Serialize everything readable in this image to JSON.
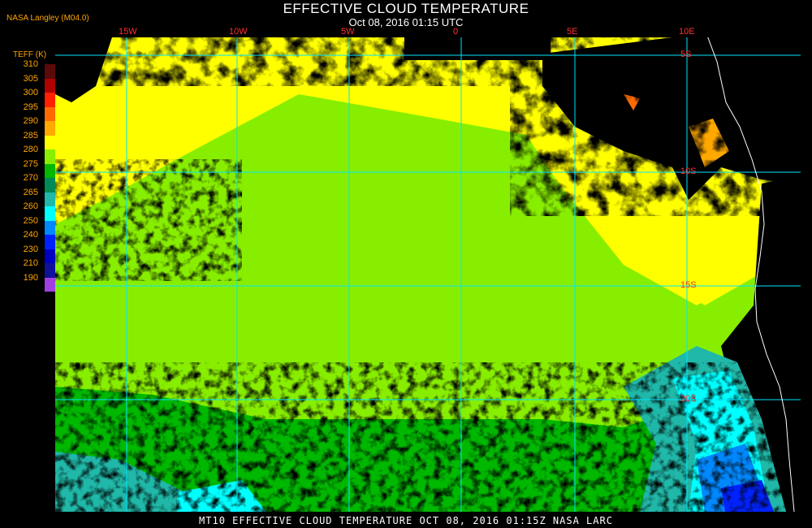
{
  "header": {
    "title": "EFFECTIVE CLOUD TEMPERATURE",
    "subtitle": "Oct 08, 2016 01:15 UTC",
    "source": "NASA Langley (M04.0)"
  },
  "legend": {
    "title": "TEFF (K)",
    "entries": [
      {
        "label": "310",
        "color": "#5a0a0a"
      },
      {
        "label": "305",
        "color": "#b00000"
      },
      {
        "label": "300",
        "color": "#ff2000"
      },
      {
        "label": "295",
        "color": "#ff6a00"
      },
      {
        "label": "290",
        "color": "#ffa800"
      },
      {
        "label": "285",
        "color": "#ffff00"
      },
      {
        "label": "280",
        "color": "#88ee00"
      },
      {
        "label": "275",
        "color": "#00b800"
      },
      {
        "label": "270",
        "color": "#008a55"
      },
      {
        "label": "265",
        "color": "#20b8a8"
      },
      {
        "label": "260",
        "color": "#00ffff"
      },
      {
        "label": "250",
        "color": "#0088ff"
      },
      {
        "label": "240",
        "color": "#0022ff"
      },
      {
        "label": "230",
        "color": "#0000c0"
      },
      {
        "label": "210",
        "color": "#10109a"
      },
      {
        "label": "190",
        "color": "#a040e0"
      }
    ]
  },
  "map": {
    "longitude_labels": [
      "15W",
      "10W",
      "5W",
      "0",
      "5E",
      "10E"
    ],
    "latitude_labels": [
      "5S",
      "10S",
      "15S",
      "20S"
    ],
    "grid_color": "#00e5ff",
    "coastline_color": "#ffffff"
  },
  "footer": "MT10  EFFECTIVE CLOUD TEMPERATURE  OCT 08, 2016 01:15Z  NASA LARC"
}
